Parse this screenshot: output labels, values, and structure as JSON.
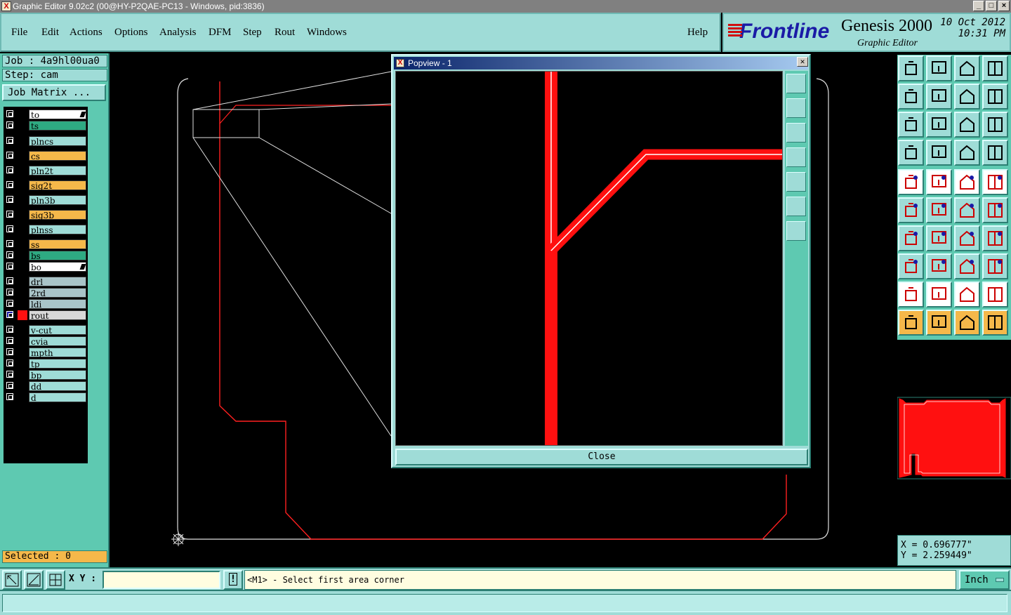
{
  "window": {
    "title": "Graphic Editor 9.02c2 (00@HY-P2QAE-PC13 - Windows, pid:3836)",
    "buttons": [
      "_",
      "□",
      "×"
    ]
  },
  "menu": {
    "items": [
      "File",
      "Edit",
      "Actions",
      "Options",
      "Analysis",
      "DFM",
      "Step",
      "Rout",
      "Windows"
    ],
    "help": "Help"
  },
  "logo": {
    "brand": "Frontline",
    "product": "Genesis 2000",
    "subtitle": "Graphic Editor",
    "date": "10 Oct 2012",
    "time": "10:31 PM"
  },
  "job": {
    "job_label": "Job : 4a9hl00ua0",
    "step_label": "Step: cam",
    "matrix_button": "Job Matrix ..."
  },
  "layers": [
    {
      "name": "to",
      "color": "#ffffff",
      "marker": true
    },
    {
      "name": "ts",
      "color": "#2eaa82"
    },
    {
      "name": "plncs",
      "color": "#9fdcd7"
    },
    {
      "name": "cs",
      "color": "#f5b84a"
    },
    {
      "name": "pln2t",
      "color": "#9fdcd7"
    },
    {
      "name": "sig2t",
      "color": "#f5b84a"
    },
    {
      "name": "pln3b",
      "color": "#9fdcd7"
    },
    {
      "name": "sig3b",
      "color": "#f5b84a"
    },
    {
      "name": "plnss",
      "color": "#9fdcd7"
    },
    {
      "name": "ss",
      "color": "#f5b84a"
    },
    {
      "name": "bs",
      "color": "#2eaa82"
    },
    {
      "name": "bo",
      "color": "#ffffff",
      "marker": true
    },
    {
      "name": "drl",
      "color": "#a9c4c8"
    },
    {
      "name": "2rd",
      "color": "#a9c4c8"
    },
    {
      "name": "ldi",
      "color": "#a9c4c8"
    },
    {
      "name": "rout",
      "color": "#d8d8d8",
      "active": true
    },
    {
      "name": "v-cut",
      "color": "#9fdcd7"
    },
    {
      "name": "cvia",
      "color": "#9fdcd7"
    },
    {
      "name": "mpth",
      "color": "#9fdcd7"
    },
    {
      "name": "tp",
      "color": "#9fdcd7"
    },
    {
      "name": "bp",
      "color": "#9fdcd7"
    },
    {
      "name": "dd",
      "color": "#9fdcd7"
    },
    {
      "name": "d",
      "color": "#9fdcd7"
    }
  ],
  "selected": "Selected : 0",
  "popview": {
    "title": "Popview - 1",
    "close_label": "Close"
  },
  "coords": {
    "x": "X = 0.696777\"",
    "y": "Y = 2.259449\""
  },
  "bottom": {
    "xy_label": "X Y :",
    "xy_value": "",
    "alert_glyph": "!",
    "message": "<M1> - Select first area corner",
    "units": "Inch"
  },
  "colors": {
    "teal": "#5ec9b1",
    "panel": "#9fdcd7",
    "accent_orange": "#f5b84a",
    "feature_red": "#ff0000"
  }
}
